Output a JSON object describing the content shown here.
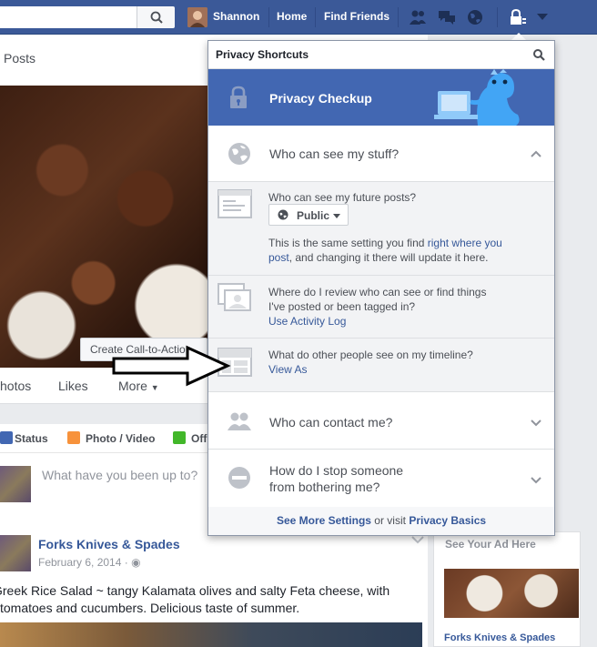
{
  "topbar": {
    "user_name": "Shannon",
    "home_label": "Home",
    "find_friends_label": "Find Friends"
  },
  "timeline": {
    "posts_tab_label": "Posts",
    "cta_label": "Create Call-to-Action",
    "tabs": [
      "hotos",
      "Likes",
      "More"
    ],
    "composer": {
      "tabs": [
        "Status",
        "Photo / Video",
        "Off"
      ],
      "placeholder": "What have you been up to?"
    },
    "post": {
      "author": "Forks Knives & Spades",
      "date": "February 6, 2014 ·",
      "text": "Greek Rice Salad ~ tangy Kalamata olives and salty Feta cheese, with tomatoes and cucumbers. Delicious taste of summer."
    }
  },
  "sidebar": {
    "ad_header": "See Your Ad Here",
    "ad_name": "Forks Knives & Spades"
  },
  "privacy": {
    "title": "Privacy Shortcuts",
    "checkup_label": "Privacy Checkup",
    "section_stuff": "Who can see my stuff?",
    "future_posts_question": "Who can see my future posts?",
    "public_label": "Public",
    "setting_note_1": "This is the same setting you find ",
    "setting_note_link": "right where you post",
    "setting_note_2": ", and changing it there will update it here.",
    "review_question_1": "Where do I review who can see or find things",
    "review_question_2": "I've posted or been tagged in?",
    "activity_log_link": "Use Activity Log",
    "timeline_question": "What do other people see on my timeline?",
    "view_as_link": "View As",
    "section_contact": "Who can contact me?",
    "section_block_1": "How do I stop someone",
    "section_block_2": "from bothering me?",
    "footer_link_1": "See More Settings",
    "footer_mid": " or visit ",
    "footer_link_2": "Privacy Basics"
  },
  "colors": {
    "brand_blue": "#3b5998",
    "checkup_blue": "#4267b2",
    "link": "#365899"
  }
}
